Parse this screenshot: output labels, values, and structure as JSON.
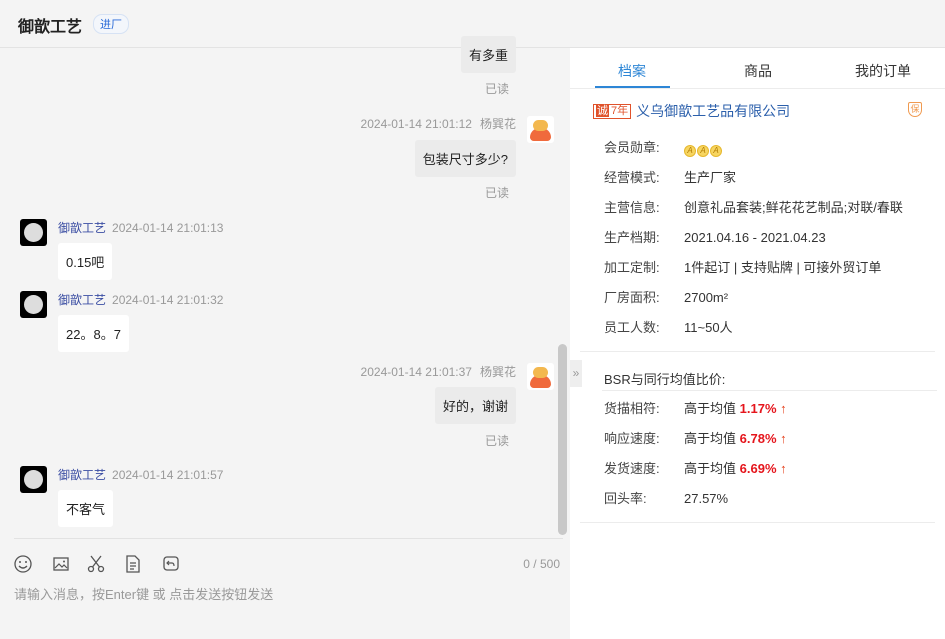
{
  "header": {
    "title": "御歆工艺",
    "badge": "进厂"
  },
  "chat": {
    "messages": [
      {
        "text": "有多重",
        "read": "已读"
      },
      {
        "sender": "杨巽花",
        "time": "2024-01-14 21:01:12",
        "text": "包装尺寸多少?",
        "read": "已读"
      },
      {
        "sender": "御歆工艺",
        "time": "2024-01-14 21:01:13",
        "text": "0.15吧"
      },
      {
        "sender": "御歆工艺",
        "time": "2024-01-14 21:01:32",
        "text": "22。8。7"
      },
      {
        "sender": "杨巽花",
        "time": "2024-01-14 21:01:37",
        "text": "好的，谢谢",
        "read": "已读"
      },
      {
        "sender": "御歆工艺",
        "time": "2024-01-14 21:01:57",
        "text": "不客气"
      }
    ],
    "counter": "0 / 500",
    "placeholder": "请输入消息，按Enter键 或 点击发送按钮发送"
  },
  "panel": {
    "tabs": [
      "档案",
      "商品",
      "我的订单"
    ],
    "company": {
      "years_badge": "诚",
      "years": "7年",
      "name": "义乌御歆工艺品有限公司",
      "shield": "保"
    },
    "info": [
      {
        "label": "会员勋章:",
        "value": ""
      },
      {
        "label": "经营模式:",
        "value": "生产厂家"
      },
      {
        "label": "主营信息:",
        "value": "创意礼品套装;鲜花花艺制品;对联/春联"
      },
      {
        "label": "生产档期:",
        "value": "2021.04.16 - 2021.04.23"
      },
      {
        "label": "加工定制:",
        "value": "1件起订 | 支持贴牌 | 可接外贸订单"
      },
      {
        "label": "厂房面积:",
        "value": "2700m²"
      },
      {
        "label": "员工人数:",
        "value": "11~50人"
      }
    ],
    "bsr_title": "BSR与同行均值比价:",
    "bsr": [
      {
        "label": "货描相符:",
        "prefix": "高于均值",
        "value": "1.17%",
        "arrow": "↑"
      },
      {
        "label": "响应速度:",
        "prefix": "高于均值",
        "value": "6.78%",
        "arrow": "↑"
      },
      {
        "label": "发货速度:",
        "prefix": "高于均值",
        "value": "6.69%",
        "arrow": "↑"
      }
    ],
    "repeat": {
      "label": "回头率:",
      "value": "27.57%"
    }
  }
}
